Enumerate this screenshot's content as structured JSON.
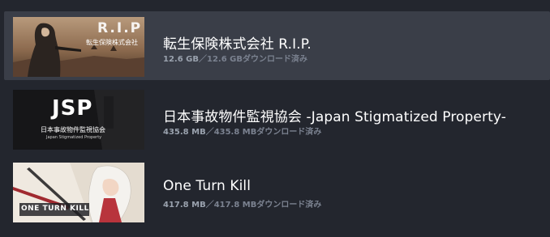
{
  "downloads": [
    {
      "title": "転生保険株式会社 R.I.P.",
      "downloaded": "12.6 GB",
      "separator": "／",
      "total": "12.6 GB",
      "status": "ダウンロード済み",
      "art": {
        "logo": "R.I.P",
        "subtitle": "転生保険株式会社"
      }
    },
    {
      "title": "日本事故物件監視協会 -Japan Stigmatized Property-",
      "downloaded": "435.8 MB",
      "separator": "／",
      "total": "435.8 MB",
      "status": "ダウンロード済み",
      "art": {
        "logo": "JSP",
        "subtitle": "日本事故物件監視協会",
        "tagline": "Japan Stigmatized Property"
      }
    },
    {
      "title": "One Turn Kill",
      "downloaded": "417.8 MB",
      "separator": "／",
      "total": "417.8 MB",
      "status": "ダウンロード済み",
      "art": {
        "logo": "ONE TURN KILL"
      }
    }
  ],
  "colors": {
    "background": "#23262e",
    "selected_row": "#3a3e48",
    "title_text": "#ffffff",
    "meta_text": "#9098a6"
  }
}
